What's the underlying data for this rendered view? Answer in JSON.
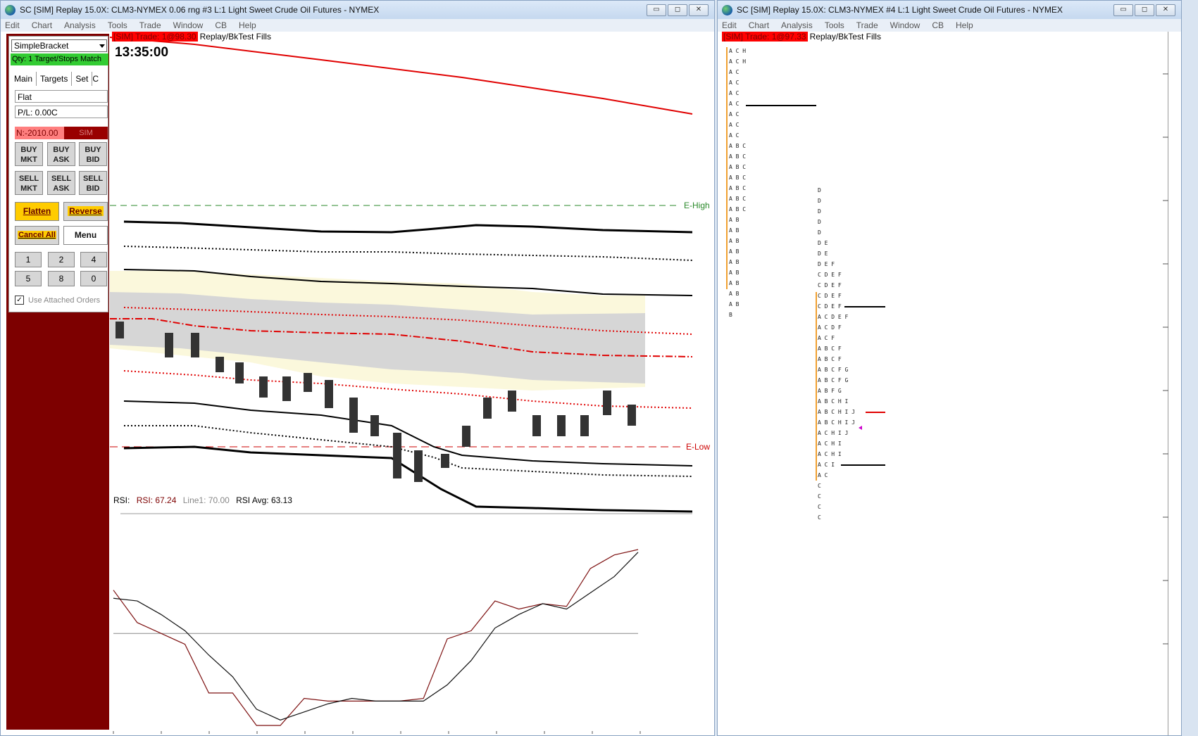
{
  "window1": {
    "title": "SC [SIM] Replay 15.0X: CLM3-NYMEX  0.06 rng  #3  L:1  Light Sweet Crude Oil Futures - NYMEX",
    "menu": [
      "Edit",
      "Chart",
      "Analysis",
      "Tools",
      "Trade",
      "Window",
      "CB",
      "Help"
    ],
    "buttons": {
      "minimize": "▭",
      "restore": "◻",
      "close": "✕"
    }
  },
  "window2": {
    "title": "SC [SIM] Replay 15.0X: CLM3-NYMEX  #4  L:1  Light Sweet Crude Oil Futures - NYMEX",
    "menu": [
      "Edit",
      "Chart",
      "Analysis",
      "Tools",
      "Trade",
      "Window",
      "CB",
      "Help"
    ]
  },
  "trade_panel": {
    "strategy": "SimpleBracket",
    "qty_line": "Qty: 1 Target/Stops Match",
    "tabs": [
      "Main",
      "Targets",
      "Set",
      "C"
    ],
    "position": "Flat",
    "pl": "P/L: 0.00C",
    "n_value": "N:-2010.00",
    "sim": "SIM",
    "buy_mkt": "BUY\nMKT",
    "buy_ask": "BUY\nASK",
    "buy_bid": "BUY\nBID",
    "sell_mkt": "SELL\nMKT",
    "sell_ask": "SELL\nASK",
    "sell_bid": "SELL\nBID",
    "flatten": "Flatten",
    "reverse": "Reverse",
    "cancel_all": "Cancel All",
    "menu": "Menu",
    "quantities": [
      "1",
      "2",
      "4",
      "5",
      "8",
      "0"
    ],
    "use_attached": "Use Attached Orders"
  },
  "chart1": {
    "sim_tag": "[SIM]  Trade: 1@98.30",
    "fills_label": "Replay/BkTest Fills",
    "time": "13:35:00",
    "e_high": "E-High",
    "e_low": "E-Low",
    "rsi_prefix": "RSI:",
    "rsi_value": "RSI: 67.24",
    "line1": "Line1: 70.00",
    "rsi_avg": "RSI Avg: 63.13",
    "colors": {
      "trade_line": "#e00000",
      "e_high": "#2b8a2b",
      "e_low": "#cc0000",
      "value_band": "#fbf8dc",
      "value_area": "#d6d6d6"
    }
  },
  "chart2": {
    "sim_tag": "[SIM]  Trade: 1@97.33",
    "fills_label": "Replay/BkTest Fills",
    "profile1": [
      "A C H",
      "A C H",
      "A C",
      "A C",
      "A C",
      "A C",
      "A C",
      "A C",
      "A C",
      "A B C",
      "A B C",
      "A B C",
      "A B C",
      "A B C",
      "A B C",
      "A B C",
      "A B",
      "A B",
      "A B",
      "A B",
      "A B",
      "A B",
      "A B",
      "A B",
      "A B",
      "B"
    ],
    "profile2": [
      "D",
      "D",
      "D",
      "D",
      "D",
      "D E",
      "D E",
      "D E F",
      "C D E F",
      "C D E F",
      "C D E F",
      "C D E F",
      "A C D E F",
      "A C D F",
      "A C F",
      "A B C F",
      "A B C F",
      "A B C F G",
      "A B C F G",
      "A B F G",
      "A B C H I",
      "A B C H I J",
      "A B C H I J",
      "A C H I J",
      "A C H I",
      "A C H I",
      "A C I",
      "A C",
      "C",
      "C",
      "C",
      "C"
    ]
  },
  "rsi_data": {
    "rsi": [
      72,
      60,
      56,
      52,
      34,
      34,
      22,
      22,
      32,
      31,
      31,
      31,
      31,
      32,
      54,
      57,
      68,
      65,
      67,
      66,
      80,
      85,
      87
    ],
    "avg": [
      69,
      68,
      63,
      57,
      48,
      40,
      28,
      24,
      27,
      30,
      32,
      31,
      31,
      31,
      37,
      46,
      58,
      63,
      67,
      65,
      71,
      77,
      86
    ],
    "line1": 70
  }
}
